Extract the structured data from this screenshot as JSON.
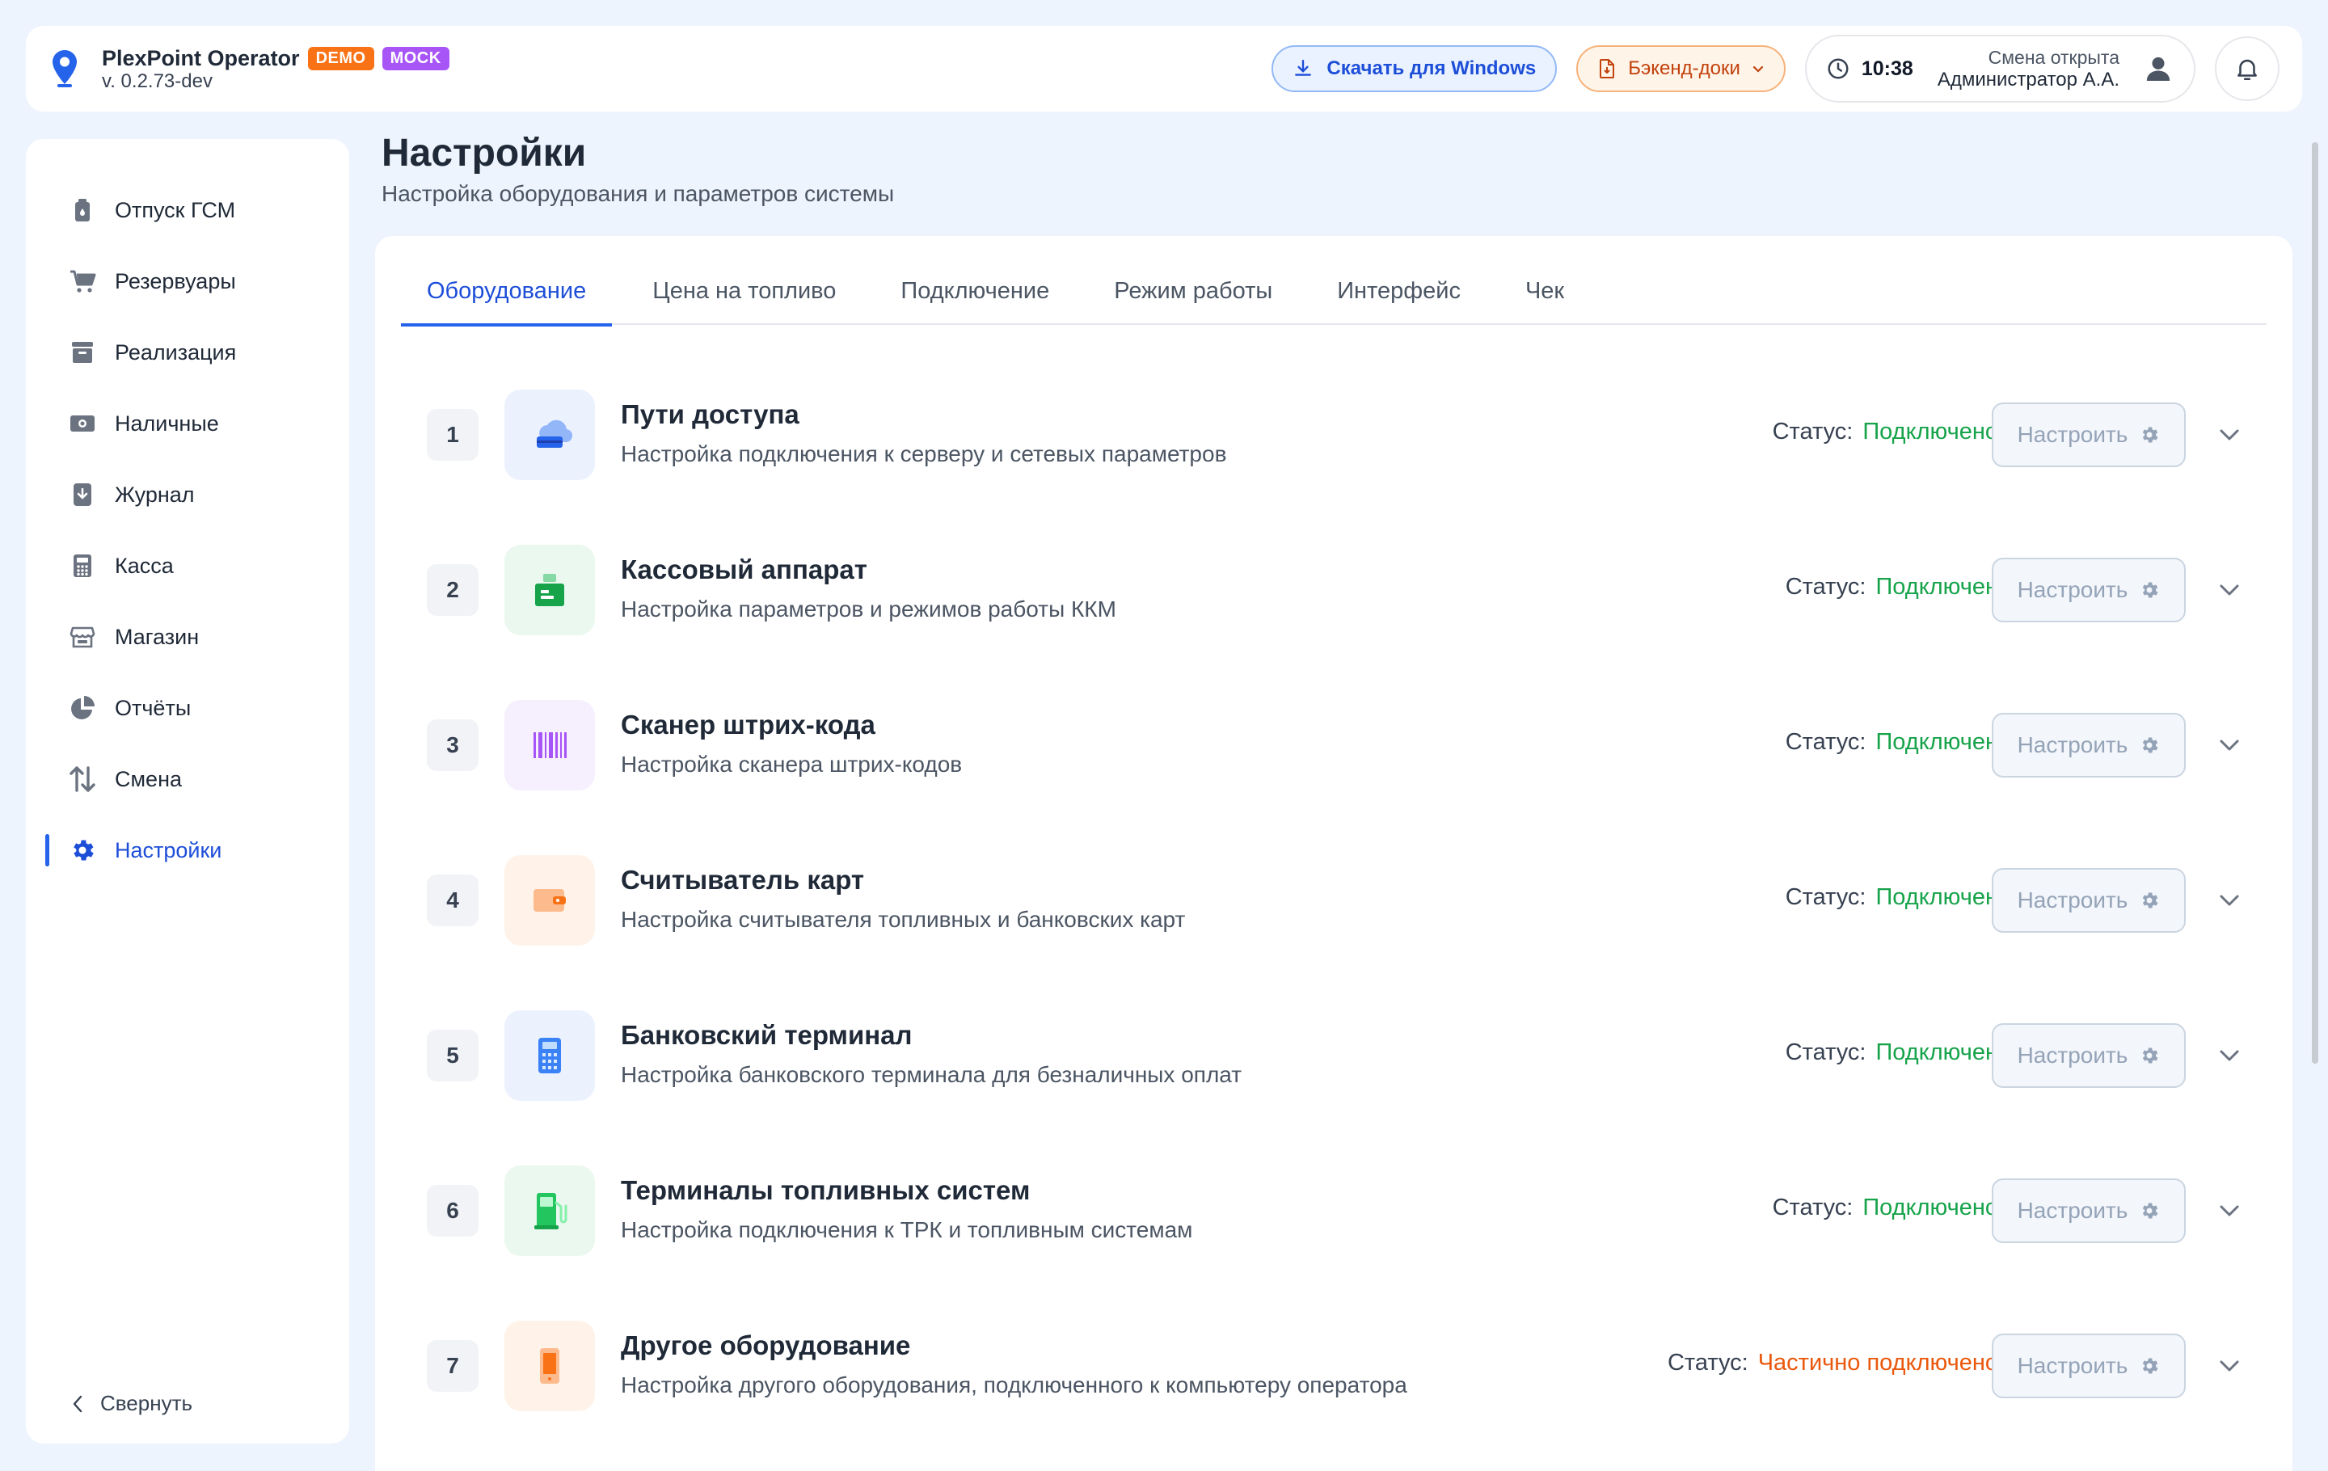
{
  "header": {
    "brand_name": "PlexPoint Operator",
    "badge_demo": "DEMO",
    "badge_mock": "MOCK",
    "version": "v. 0.2.73-dev",
    "download_label": "Скачать для Windows",
    "docs_label": "Бэкенд-доки",
    "time": "10:38",
    "shift_status": "Смена открыта",
    "user_name": "Администратор А.А."
  },
  "sidebar": {
    "items": [
      {
        "label": "Отпуск ГСМ",
        "icon": "fuel-canister-icon"
      },
      {
        "label": "Резервуары",
        "icon": "cart-icon"
      },
      {
        "label": "Реализация",
        "icon": "archive-box-icon"
      },
      {
        "label": "Наличные",
        "icon": "cash-icon"
      },
      {
        "label": "Журнал",
        "icon": "download-doc-icon"
      },
      {
        "label": "Касса",
        "icon": "calculator-icon"
      },
      {
        "label": "Магазин",
        "icon": "store-icon"
      },
      {
        "label": "Отчёты",
        "icon": "pie-chart-icon"
      },
      {
        "label": "Смена",
        "icon": "arrows-up-down-icon"
      },
      {
        "label": "Настройки",
        "icon": "gear-icon",
        "active": true
      }
    ],
    "collapse_label": "Свернуть"
  },
  "page": {
    "title": "Настройки",
    "subtitle": "Настройка оборудования и параметров системы"
  },
  "tabs": [
    "Оборудование",
    "Цена на топливо",
    "Подключение",
    "Режим работы",
    "Интерфейс",
    "Чек"
  ],
  "status_prefix": "Статус:",
  "configure_label": "Настроить",
  "equipment": [
    {
      "num": "1",
      "title": "Пути доступа",
      "desc": "Настройка подключения к серверу и сетевых параметров",
      "status": "Подключено",
      "state": "ok",
      "icon": "cloud-server-icon"
    },
    {
      "num": "2",
      "title": "Кассовый аппарат",
      "desc": "Настройка параметров и режимов работы ККМ",
      "status": "Подключен",
      "state": "ok",
      "icon": "cash-register-icon"
    },
    {
      "num": "3",
      "title": "Сканер штрих-кода",
      "desc": "Настройка сканера штрих-кодов",
      "status": "Подключен",
      "state": "ok",
      "icon": "barcode-icon"
    },
    {
      "num": "4",
      "title": "Считыватель карт",
      "desc": "Настройка считывателя топливных и банковских карт",
      "status": "Подключен",
      "state": "ok",
      "icon": "wallet-icon"
    },
    {
      "num": "5",
      "title": "Банковский терминал",
      "desc": "Настройка банковского терминала для безналичных оплат",
      "status": "Подключен",
      "state": "ok",
      "icon": "pos-terminal-icon"
    },
    {
      "num": "6",
      "title": "Терминалы топливных систем",
      "desc": "Настройка подключения к ТРК и топливным системам",
      "status": "Подключено",
      "state": "ok",
      "icon": "fuel-pump-icon"
    },
    {
      "num": "7",
      "title": "Другое оборудование",
      "desc": "Настройка другого оборудования, подключенного к компьютеру оператора",
      "status": "Частично подключено",
      "state": "partial",
      "icon": "smartphone-icon"
    }
  ],
  "colors": {
    "accent": "#2563eb",
    "status_ok": "#16a34a",
    "status_partial": "#ea580c",
    "badge_demo": "#f97316",
    "badge_mock": "#a855f7"
  }
}
